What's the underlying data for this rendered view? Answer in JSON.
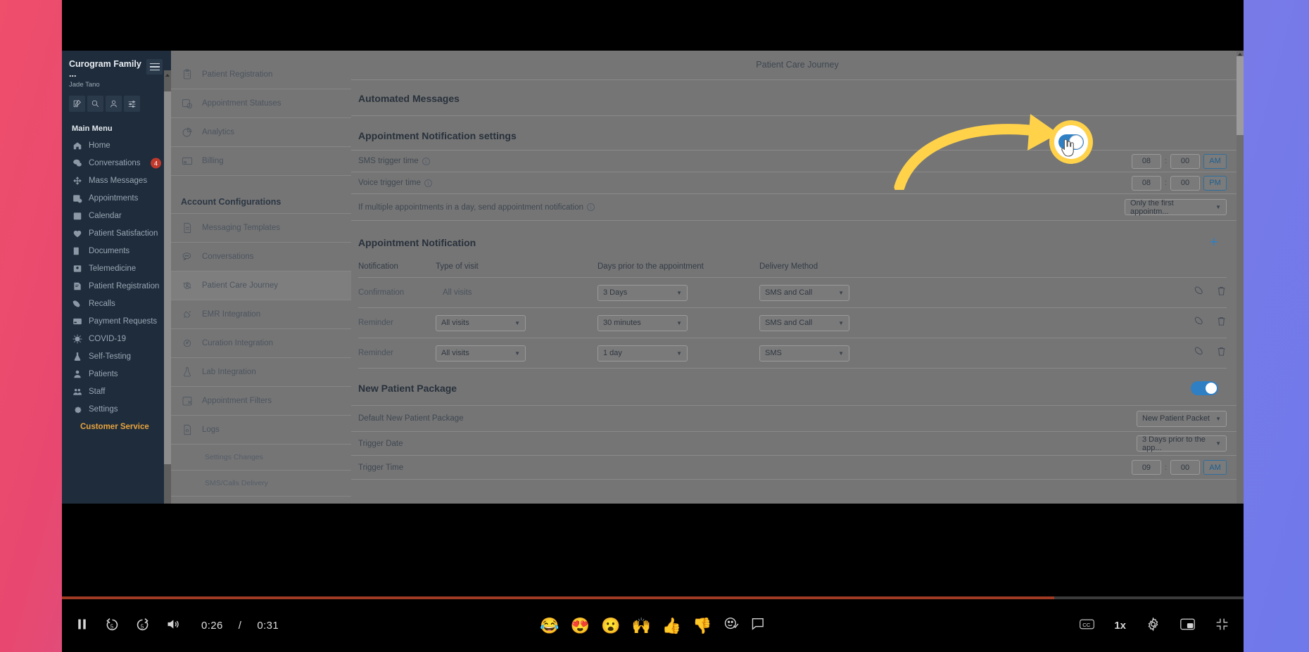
{
  "sidebar": {
    "account": "Curogram Family ...",
    "user": "Jade Tano",
    "actions": [
      "compose-icon",
      "search-icon",
      "patient-icon",
      "filters-icon"
    ],
    "section": "Main Menu",
    "items": [
      {
        "label": "Home",
        "icon": "home-icon"
      },
      {
        "label": "Conversations",
        "icon": "chat-icon",
        "badge": "4"
      },
      {
        "label": "Mass Messages",
        "icon": "broadcast-icon"
      },
      {
        "label": "Appointments",
        "icon": "appointments-icon"
      },
      {
        "label": "Calendar",
        "icon": "calendar-icon"
      },
      {
        "label": "Patient Satisfaction",
        "icon": "heart-icon"
      },
      {
        "label": "Documents",
        "icon": "documents-icon"
      },
      {
        "label": "Telemedicine",
        "icon": "telemedicine-icon"
      },
      {
        "label": "Patient Registration",
        "icon": "registration-icon"
      },
      {
        "label": "Recalls",
        "icon": "recalls-icon"
      },
      {
        "label": "Payment Requests",
        "icon": "card-icon"
      },
      {
        "label": "COVID-19",
        "icon": "virus-icon"
      },
      {
        "label": "Self-Testing",
        "icon": "flask-icon"
      },
      {
        "label": "Patients",
        "icon": "person-icon"
      },
      {
        "label": "Staff",
        "icon": "staff-icon"
      },
      {
        "label": "Settings",
        "icon": "gear-icon"
      }
    ],
    "customer_service": "Customer Service"
  },
  "nav2": {
    "top_items": [
      {
        "label": "Patient Registration",
        "icon": "clipboard-icon"
      },
      {
        "label": "Appointment Statuses",
        "icon": "calendar-clock-icon"
      },
      {
        "label": "Analytics",
        "icon": "pie-chart-icon"
      },
      {
        "label": "Billing",
        "icon": "card-icon"
      }
    ],
    "section": "Account Configurations",
    "config_items": [
      {
        "label": "Messaging Templates",
        "icon": "document-icon",
        "active": false
      },
      {
        "label": "Conversations",
        "icon": "chat-icon",
        "active": false
      },
      {
        "label": "Patient Care Journey",
        "icon": "journey-icon",
        "active": true
      },
      {
        "label": "EMR Integration",
        "icon": "plug-icon",
        "active": false
      },
      {
        "label": "Curation Integration",
        "icon": "curation-icon",
        "active": false
      },
      {
        "label": "Lab Integration",
        "icon": "flask-icon",
        "active": false
      },
      {
        "label": "Appointment Filters",
        "icon": "filter-calendar-icon",
        "active": false
      },
      {
        "label": "Logs",
        "icon": "logs-icon",
        "active": false
      }
    ],
    "sub_items": [
      "Settings Changes",
      "SMS/Calls Delivery"
    ]
  },
  "main": {
    "page_title": "Patient Care Journey",
    "automated_messages": {
      "title": "Automated Messages",
      "toggle_on": true
    },
    "appointment_notification_settings": {
      "title": "Appointment Notification settings",
      "rows": [
        {
          "label": "SMS trigger time",
          "info": true,
          "hour": "08",
          "minute": "00",
          "meridiem": "AM"
        },
        {
          "label": "Voice trigger time",
          "info": true,
          "hour": "08",
          "minute": "00",
          "meridiem": "PM"
        }
      ],
      "multi_label": "If multiple appointments in a day, send appointment notification",
      "multi_value": "Only the first appointm..."
    },
    "appointment_notification": {
      "title": "Appointment Notification",
      "add_label": "+",
      "columns": [
        "Notification",
        "Type of visit",
        "Days prior to the appointment",
        "Delivery Method"
      ],
      "rows": [
        {
          "notification": "Confirmation",
          "type_of_visit": "All visits",
          "type_is_select": false,
          "days_prior": "3 Days",
          "delivery": "SMS and Call"
        },
        {
          "notification": "Reminder",
          "type_of_visit": "All visits",
          "type_is_select": true,
          "days_prior": "30 minutes",
          "delivery": "SMS and Call"
        },
        {
          "notification": "Reminder",
          "type_of_visit": "All visits",
          "type_is_select": true,
          "days_prior": "1 day",
          "delivery": "SMS"
        }
      ]
    },
    "new_patient_package": {
      "title": "New Patient Package",
      "toggle_on": true,
      "rows": [
        {
          "label": "Default New Patient Package",
          "value": "New Patient Packet",
          "type": "select"
        },
        {
          "label": "Trigger Date",
          "value": "3 Days prior to the app...",
          "type": "select"
        },
        {
          "label": "Trigger Time",
          "hour": "09",
          "minute": "00",
          "meridiem": "AM",
          "type": "time"
        }
      ]
    }
  },
  "player": {
    "play_state": "pause-icon",
    "rewind_label": "5",
    "forward_label": "5",
    "current_time": "0:26",
    "separator": "/",
    "duration": "0:31",
    "progress_percent": 84,
    "reactions": [
      "😂",
      "😍",
      "😮",
      "🙌",
      "👍",
      "👎"
    ],
    "reaction_picker": "emoji-picker-icon",
    "comment": "comment-icon",
    "captions": "CC",
    "speed": "1x",
    "settings": "gear-icon",
    "pip": "picture-in-picture-icon",
    "fullscreen": "exit-fullscreen-icon"
  },
  "colors": {
    "accent": "#2f7fc4",
    "highlight": "#ffd24a",
    "badge": "#c0392b",
    "sidebar_bg": "#1e2c3c",
    "customer_service": "#e8a33d"
  }
}
